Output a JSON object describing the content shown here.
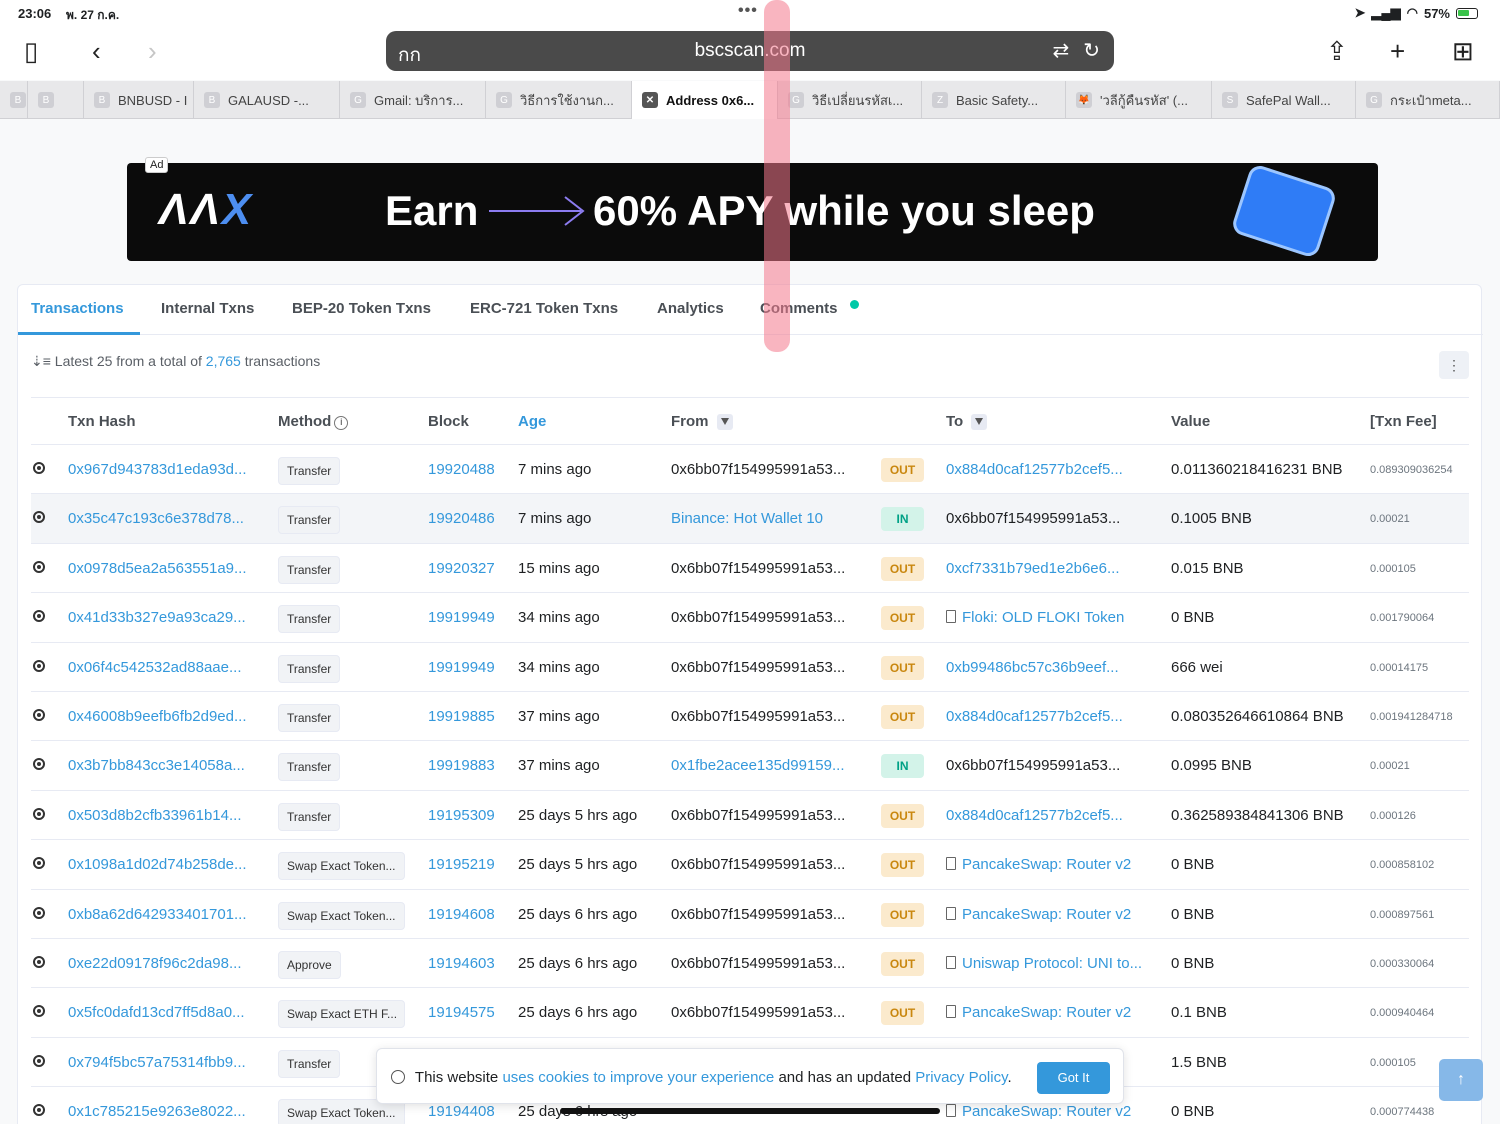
{
  "status": {
    "time": "23:06",
    "date": "พ. 27 ก.ค.",
    "battery": "57%"
  },
  "browser": {
    "aa_label": "กก",
    "url": "bscscan.com"
  },
  "tabs": [
    {
      "fav": "B",
      "label": ""
    },
    {
      "fav": "B",
      "label": ""
    },
    {
      "fav": "B",
      "label": "BNBUSD - I"
    },
    {
      "fav": "B",
      "label": "GALAUSD -..."
    },
    {
      "fav": "G",
      "label": "Gmail: บริการ..."
    },
    {
      "fav": "G",
      "label": "วิธีการใช้งานก..."
    },
    {
      "fav": "✕",
      "label": "Address 0x6..."
    },
    {
      "fav": "G",
      "label": "วิธีเปลี่ยนรหัสเ..."
    },
    {
      "fav": "Z",
      "label": "Basic Safety..."
    },
    {
      "fav": "🦊",
      "label": "'วลีกู้คืนรหัส' (..."
    },
    {
      "fav": "S",
      "label": "SafePal Wall..."
    },
    {
      "fav": "G",
      "label": "กระเป๋าmeta..."
    }
  ],
  "ad": {
    "tag": "Ad",
    "logo_a": "ΛΛ",
    "logo_b": "X",
    "earn": "Earn",
    "apy": "60% APY while you sleep"
  },
  "nav": {
    "transactions": "Transactions",
    "internal": "Internal Txns",
    "bep20": "BEP-20 Token Txns",
    "erc721": "ERC-721 Token Txns",
    "analytics": "Analytics",
    "comments": "Comments"
  },
  "summary": {
    "prefix": "Latest 25 from a total of",
    "count": "2,765",
    "suffix": "transactions",
    "more": "⋮"
  },
  "columns": {
    "hash": "Txn Hash",
    "method": "Method",
    "block": "Block",
    "age": "Age",
    "from": "From",
    "to": "To",
    "value": "Value",
    "fee": "[Txn Fee]"
  },
  "rows": [
    {
      "hash": "0x967d943783d1eda93d...",
      "method": "Transfer",
      "block": "19920488",
      "age": "7 mins ago",
      "from": "0x6bb07f154995991a53...",
      "from_link": false,
      "dir": "OUT",
      "to": "0x884d0caf12577b2cef5...",
      "to_contract": false,
      "to_link": true,
      "value": "0.011360218416231 BNB",
      "fee": "0.089309036254"
    },
    {
      "hash": "0x35c47c193c6e378d78...",
      "method": "Transfer",
      "block": "19920486",
      "age": "7 mins ago",
      "from": "Binance: Hot Wallet 10",
      "from_link": true,
      "dir": "IN",
      "to": "0x6bb07f154995991a53...",
      "to_contract": false,
      "to_link": false,
      "value": "0.1005 BNB",
      "fee": "0.00021"
    },
    {
      "hash": "0x0978d5ea2a563551a9...",
      "method": "Transfer",
      "block": "19920327",
      "age": "15 mins ago",
      "from": "0x6bb07f154995991a53...",
      "from_link": false,
      "dir": "OUT",
      "to": "0xcf7331b79ed1e2b6e6...",
      "to_contract": false,
      "to_link": true,
      "value": "0.015 BNB",
      "fee": "0.000105"
    },
    {
      "hash": "0x41d33b327e9a93ca29...",
      "method": "Transfer",
      "block": "19919949",
      "age": "34 mins ago",
      "from": "0x6bb07f154995991a53...",
      "from_link": false,
      "dir": "OUT",
      "to": "Floki: OLD FLOKI Token",
      "to_contract": true,
      "to_link": true,
      "value": "0 BNB",
      "fee": "0.001790064"
    },
    {
      "hash": "0x06f4c542532ad88aae...",
      "method": "Transfer",
      "block": "19919949",
      "age": "34 mins ago",
      "from": "0x6bb07f154995991a53...",
      "from_link": false,
      "dir": "OUT",
      "to": "0xb99486bc57c36b9eef...",
      "to_contract": false,
      "to_link": true,
      "value": "666 wei",
      "fee": "0.00014175"
    },
    {
      "hash": "0x46008b9eefb6fb2d9ed...",
      "method": "Transfer",
      "block": "19919885",
      "age": "37 mins ago",
      "from": "0x6bb07f154995991a53...",
      "from_link": false,
      "dir": "OUT",
      "to": "0x884d0caf12577b2cef5...",
      "to_contract": false,
      "to_link": true,
      "value": "0.080352646610864 BNB",
      "fee": "0.001941284718"
    },
    {
      "hash": "0x3b7bb843cc3e14058a...",
      "method": "Transfer",
      "block": "19919883",
      "age": "37 mins ago",
      "from": "0x1fbe2acee135d99159...",
      "from_link": true,
      "dir": "IN",
      "to": "0x6bb07f154995991a53...",
      "to_contract": false,
      "to_link": false,
      "value": "0.0995 BNB",
      "fee": "0.00021"
    },
    {
      "hash": "0x503d8b2cfb33961b14...",
      "method": "Transfer",
      "block": "19195309",
      "age": "25 days 5 hrs ago",
      "from": "0x6bb07f154995991a53...",
      "from_link": false,
      "dir": "OUT",
      "to": "0x884d0caf12577b2cef5...",
      "to_contract": false,
      "to_link": true,
      "value": "0.362589384841306 BNB",
      "fee": "0.000126"
    },
    {
      "hash": "0x1098a1d02d74b258de...",
      "method": "Swap Exact Token...",
      "block": "19195219",
      "age": "25 days 5 hrs ago",
      "from": "0x6bb07f154995991a53...",
      "from_link": false,
      "dir": "OUT",
      "to": "PancakeSwap: Router v2",
      "to_contract": true,
      "to_link": true,
      "value": "0 BNB",
      "fee": "0.000858102"
    },
    {
      "hash": "0xb8a62d642933401701...",
      "method": "Swap Exact Token...",
      "block": "19194608",
      "age": "25 days 6 hrs ago",
      "from": "0x6bb07f154995991a53...",
      "from_link": false,
      "dir": "OUT",
      "to": "PancakeSwap: Router v2",
      "to_contract": true,
      "to_link": true,
      "value": "0 BNB",
      "fee": "0.000897561"
    },
    {
      "hash": "0xe22d09178f96c2da98...",
      "method": "Approve",
      "block": "19194603",
      "age": "25 days 6 hrs ago",
      "from": "0x6bb07f154995991a53...",
      "from_link": false,
      "dir": "OUT",
      "to": "Uniswap Protocol: UNI to...",
      "to_contract": true,
      "to_link": true,
      "value": "0 BNB",
      "fee": "0.000330064"
    },
    {
      "hash": "0x5fc0dafd13cd7ff5d8a0...",
      "method": "Swap Exact ETH F...",
      "block": "19194575",
      "age": "25 days 6 hrs ago",
      "from": "0x6bb07f154995991a53...",
      "from_link": false,
      "dir": "OUT",
      "to": "PancakeSwap: Router v2",
      "to_contract": true,
      "to_link": true,
      "value": "0.1 BNB",
      "fee": "0.000940464"
    },
    {
      "hash": "0x794f5bc57a75314fbb9...",
      "method": "Transfer",
      "block": "",
      "age": "",
      "from": "",
      "from_link": false,
      "dir": "",
      "to": "",
      "to_contract": false,
      "to_link": false,
      "value": "1.5 BNB",
      "fee": "0.000105"
    },
    {
      "hash": "0x1c785215e9263e8022...",
      "method": "Swap Exact Token...",
      "block": "19194408",
      "age": "25 days 6 hrs ago",
      "from": "",
      "from_link": false,
      "dir": "",
      "to": "PancakeSwap: Router v2",
      "to_contract": true,
      "to_link": true,
      "value": "0 BNB",
      "fee": "0.000774438"
    }
  ],
  "cookie": {
    "text1": "This website",
    "link1": "uses cookies to improve your experience",
    "text2": "and has an updated",
    "link2": "Privacy Policy",
    "text3": ".",
    "button": "Got It"
  },
  "colors": {
    "accent": "#3498db",
    "out_bg": "#fbeacd",
    "in_bg": "#d3f3e9"
  }
}
